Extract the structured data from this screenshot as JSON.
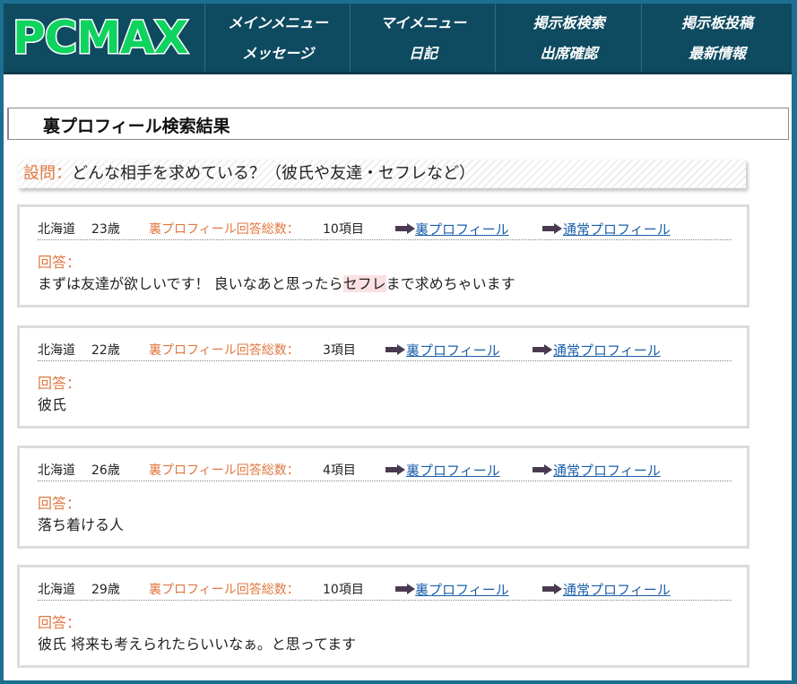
{
  "header": {
    "logo": "PCMAX",
    "nav": [
      {
        "top": "メインメニュー",
        "bottom": "メッセージ"
      },
      {
        "top": "マイメニュー",
        "bottom": "日記"
      },
      {
        "top": "掲示板検索",
        "bottom": "出席確認"
      },
      {
        "top": "掲示板投稿",
        "bottom": "最新情報"
      }
    ]
  },
  "page_title": "裏プロフィール検索結果",
  "question": {
    "label": "設問：",
    "text": "どんな相手を求めている？（彼氏や友達・セフレなど）"
  },
  "labels": {
    "count": "裏プロフィール回答総数：",
    "answer": "回答：",
    "ura_link": "裏プロフィール",
    "normal_link": "通常プロフィール"
  },
  "results": [
    {
      "region": "北海道",
      "age": "23歳",
      "count": "10項目",
      "answer_pre": "まずは友達が欲しいです！ 良いなあと思ったら",
      "answer_hl": "セフレ",
      "answer_post": "まで求めちゃいます"
    },
    {
      "region": "北海道",
      "age": "22歳",
      "count": "3項目",
      "answer_pre": "彼氏",
      "answer_hl": "",
      "answer_post": ""
    },
    {
      "region": "北海道",
      "age": "26歳",
      "count": "4項目",
      "answer_pre": "落ち着ける人",
      "answer_hl": "",
      "answer_post": ""
    },
    {
      "region": "北海道",
      "age": "29歳",
      "count": "10項目",
      "answer_pre": "彼氏 将来も考えられたらいいなぁ。と思ってます",
      "answer_hl": "",
      "answer_post": ""
    }
  ],
  "colors": {
    "accent": "#e07840",
    "link": "#1a5fa8",
    "header_bg": "#0e4a60",
    "logo_green": "#0fd35f",
    "highlight": "#fbe1e3"
  }
}
